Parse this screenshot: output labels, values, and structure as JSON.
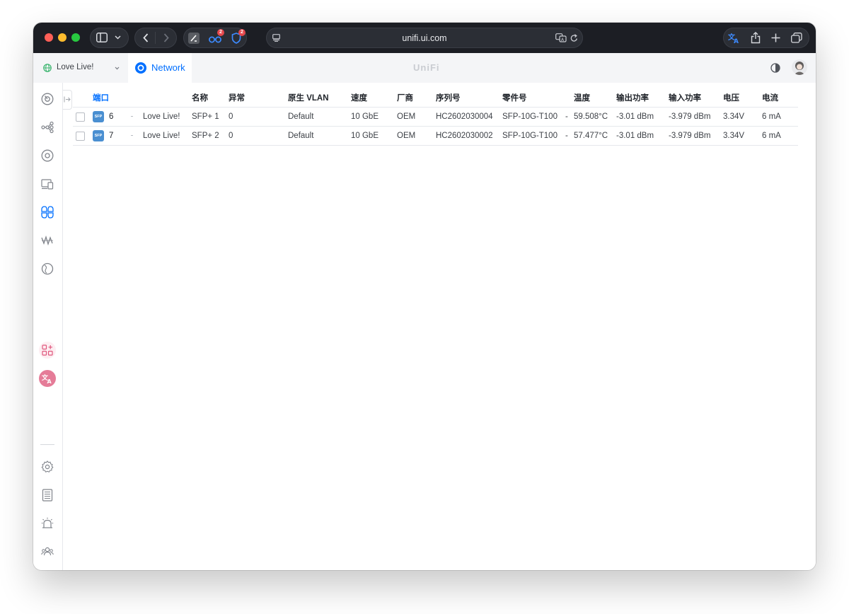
{
  "browser": {
    "url": "unifi.ui.com",
    "extension_badges": [
      "2",
      "2"
    ]
  },
  "header": {
    "site_name": "Love Live!",
    "app_tab": "Network",
    "brand": "UniFi"
  },
  "sidebar": {
    "top_icons": [
      "dashboard-icon",
      "topology-icon",
      "devices-icon",
      "client-devices-icon",
      "ports-icon",
      "insights-icon",
      "location-icon"
    ],
    "app_icons": [
      "innerspace-icon",
      "translate-icon"
    ],
    "bottom_icons": [
      "settings-icon",
      "logs-icon",
      "alarm-icon",
      "admins-icon"
    ]
  },
  "table": {
    "headers": {
      "port": "端口",
      "name": "名称",
      "anomaly": "异常",
      "native_vlan": "原生 VLAN",
      "speed": "速度",
      "vendor": "厂商",
      "serial": "序列号",
      "part": "零件号",
      "temp": "温度",
      "tx_power": "输出功率",
      "rx_power": "输入功率",
      "voltage": "电压",
      "current": "电流"
    },
    "rows": [
      {
        "type": "SFP",
        "port": "6",
        "device": "Love Live!",
        "name": "SFP+ 1",
        "anomaly": "0",
        "native_vlan": "Default",
        "speed": "10 GbE",
        "vendor": "OEM",
        "serial": "HC2602030004",
        "part": "SFP-10G-T100",
        "part_extra": "-",
        "temp": "59.508°C",
        "tx_power": "-3.01 dBm",
        "rx_power": "-3.979 dBm",
        "voltage": "3.34V",
        "current": "6 mA"
      },
      {
        "type": "SFP",
        "port": "7",
        "device": "Love Live!",
        "name": "SFP+ 2",
        "anomaly": "0",
        "native_vlan": "Default",
        "speed": "10 GbE",
        "vendor": "OEM",
        "serial": "HC2602030002",
        "part": "SFP-10G-T100",
        "part_extra": "-",
        "temp": "57.477°C",
        "tx_power": "-3.01 dBm",
        "rx_power": "-3.979 dBm",
        "voltage": "3.34V",
        "current": "6 mA"
      }
    ]
  },
  "colors": {
    "accent": "#006fff",
    "anomaly_zero": "#2fb36b",
    "speed": "#3d93d9",
    "chrome_dark": "#1c1e24"
  }
}
